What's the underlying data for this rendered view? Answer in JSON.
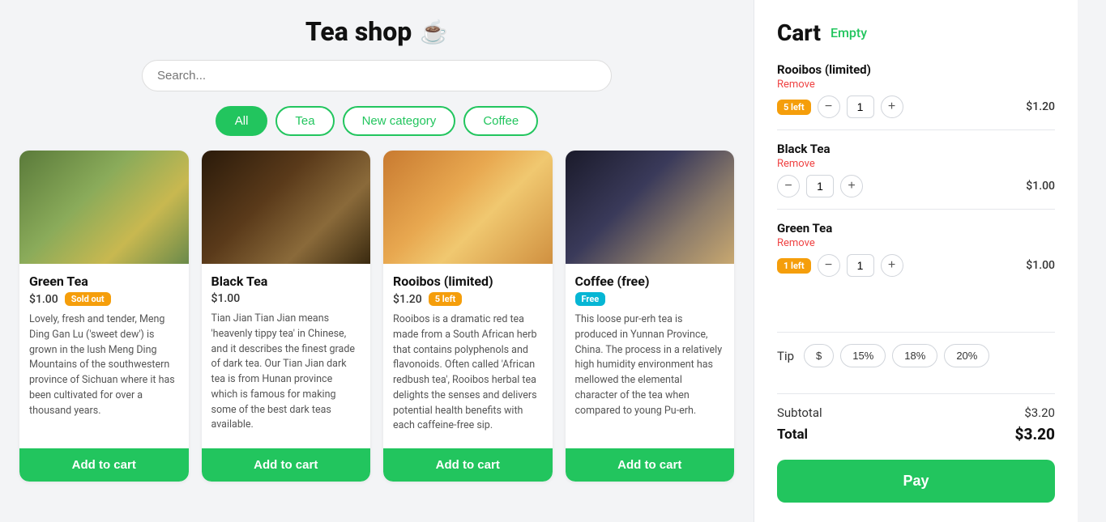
{
  "header": {
    "title": "Tea shop",
    "icon": "☕"
  },
  "search": {
    "placeholder": "Search..."
  },
  "filters": [
    {
      "id": "all",
      "label": "All",
      "active": true
    },
    {
      "id": "tea",
      "label": "Tea",
      "active": false
    },
    {
      "id": "new-category",
      "label": "New category",
      "active": false
    },
    {
      "id": "coffee",
      "label": "Coffee",
      "active": false
    }
  ],
  "products": [
    {
      "id": "green-tea",
      "name": "Green Tea",
      "price": "$1.00",
      "badge": "Sold out",
      "badge_type": "sold-out",
      "description": "Lovely, fresh and tender, Meng Ding Gan Lu ('sweet dew') is grown in the lush Meng Ding Mountains of the southwestern province of Sichuan where it has been cultivated for over a thousand years.",
      "add_label": "Add to cart",
      "img_class": "img-green-tea"
    },
    {
      "id": "black-tea",
      "name": "Black Tea",
      "price": "$1.00",
      "badge": "",
      "badge_type": "",
      "description": "Tian Jian Tian Jian means 'heavenly tippy tea' in Chinese, and it describes the finest grade of dark tea. Our Tian Jian dark tea is from Hunan province which is famous for making some of the best dark teas available.",
      "add_label": "Add to cart",
      "img_class": "img-black-tea"
    },
    {
      "id": "rooibos",
      "name": "Rooibos (limited)",
      "price": "$1.20",
      "badge": "5 left",
      "badge_type": "left",
      "description": "Rooibos is a dramatic red tea made from a South African herb that contains polyphenols and flavonoids. Often called 'African redbush tea', Rooibos herbal tea delights the senses and delivers potential health benefits with each caffeine-free sip.",
      "add_label": "Add to cart",
      "img_class": "img-rooibos"
    },
    {
      "id": "coffee",
      "name": "Coffee (free)",
      "price": "",
      "badge": "Free",
      "badge_type": "free",
      "description": "This loose pur-erh tea is produced in Yunnan Province, China. The process in a relatively high humidity environment has mellowed the elemental character of the tea when compared to young Pu-erh.",
      "add_label": "Add to cart",
      "img_class": "img-coffee"
    }
  ],
  "cart": {
    "title": "Cart",
    "empty_label": "Empty",
    "items": [
      {
        "id": "rooibos",
        "name": "Rooibos (limited)",
        "remove_label": "Remove",
        "badge": "5 left",
        "badge_type": "orange",
        "qty": 1,
        "price": "$1.20"
      },
      {
        "id": "black-tea",
        "name": "Black Tea",
        "remove_label": "Remove",
        "badge": "",
        "badge_type": "",
        "qty": 1,
        "price": "$1.00"
      },
      {
        "id": "green-tea",
        "name": "Green Tea",
        "remove_label": "Remove",
        "badge": "1 left",
        "badge_type": "orange",
        "qty": 1,
        "price": "$1.00"
      }
    ],
    "tip": {
      "label": "Tip",
      "dollar_label": "$",
      "options": [
        "15%",
        "18%",
        "20%"
      ]
    },
    "subtotal_label": "Subtotal",
    "subtotal_value": "$3.20",
    "total_label": "Total",
    "total_value": "$3.20",
    "pay_label": "Pay"
  }
}
